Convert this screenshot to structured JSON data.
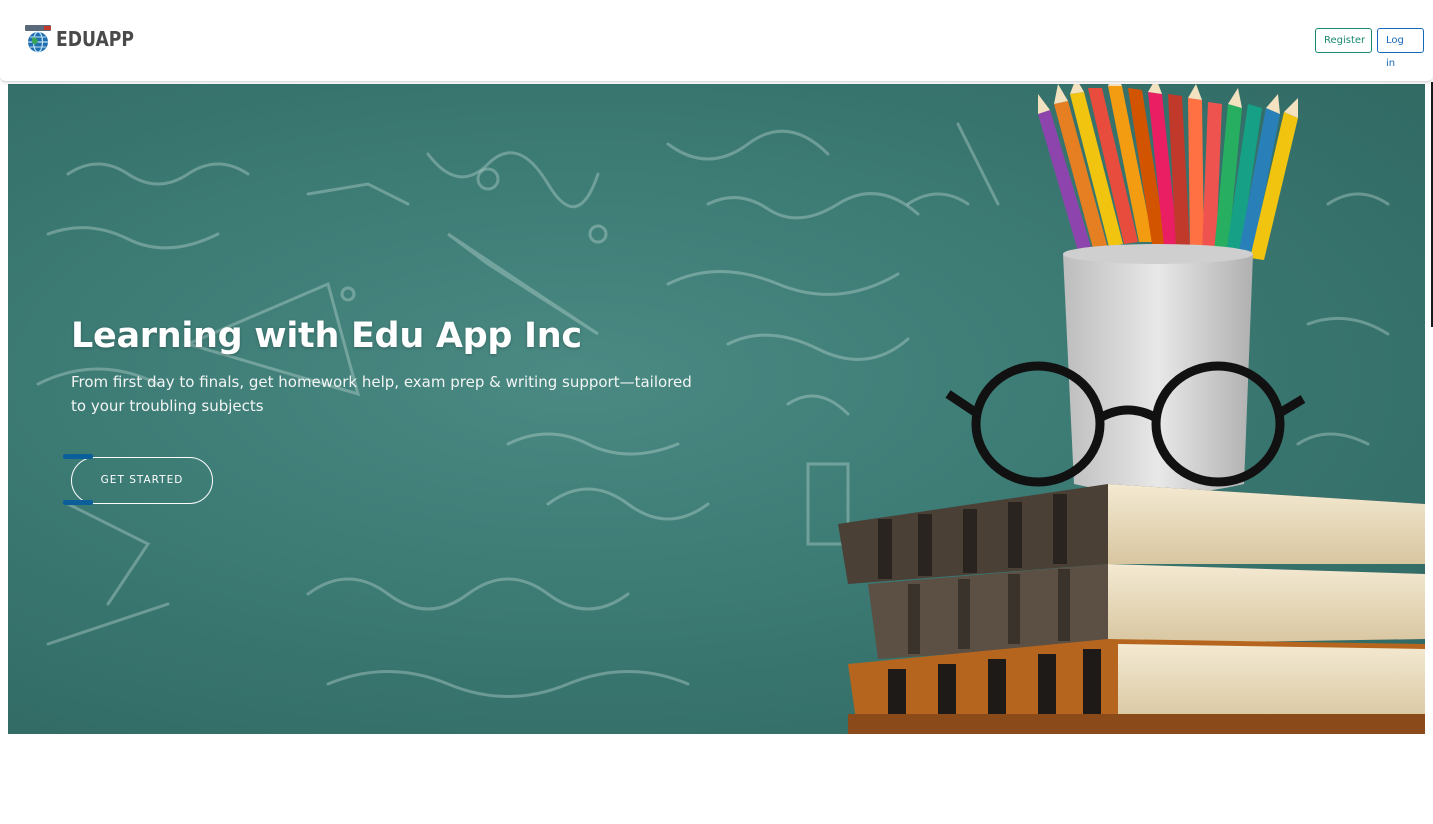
{
  "header": {
    "brand": {
      "name": "EDUAPP",
      "icon": "globe-icon"
    },
    "register_label": "Register",
    "login_label": "Log in",
    "colors": {
      "register": "#1a8a6e",
      "login": "#1669b8"
    }
  },
  "hero": {
    "title": "Learning with Edu App Inc",
    "subtitle": "From first day to finals, get homework help, exam prep & writing support—tailored to your troubling subjects",
    "cta_label": "GET STARTED",
    "background": "chalkboard-with-pencils-books-glasses",
    "colors": {
      "board": "#3c7a74",
      "cta_accent": "#0a5f9a"
    }
  }
}
